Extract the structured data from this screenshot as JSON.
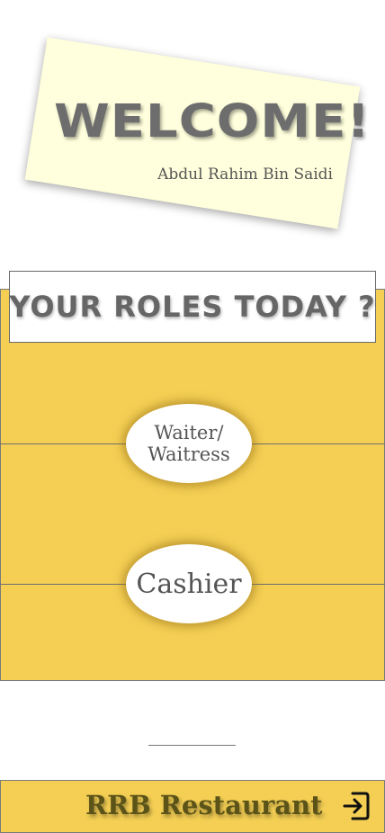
{
  "welcome": {
    "title": "WELCOME!",
    "user_name": "Abdul Rahim Bin Saidi",
    "card_color": "#ffffdd"
  },
  "roles": {
    "heading": "YOUR ROLES TODAY ?",
    "options": [
      {
        "label": "Waiter/\nWaitress"
      },
      {
        "label": "Cashier"
      }
    ],
    "panel_color": "#f4cf54"
  },
  "footer": {
    "title": "RRB Restaurant",
    "icon": "logout-icon",
    "title_color": "#5b5318"
  }
}
